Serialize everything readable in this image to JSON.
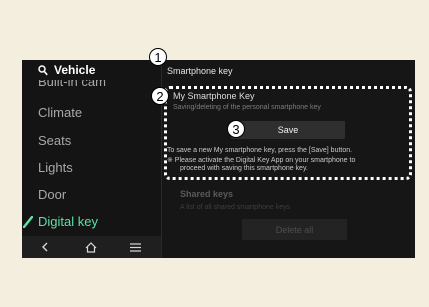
{
  "sidebar": {
    "title": "Vehicle",
    "items": [
      {
        "label": "Built-in cam"
      },
      {
        "label": "Climate"
      },
      {
        "label": "Seats"
      },
      {
        "label": "Lights"
      },
      {
        "label": "Door"
      },
      {
        "label": "Digital key"
      }
    ]
  },
  "content": {
    "title": "Smartphone key",
    "my_key": {
      "title": "My Smartphone Key",
      "subtitle": "Saving/deleting of the personal smartphone key",
      "save_label": "Save",
      "note_line1": "To save a new My smartphone key, press the [Save] button.",
      "note_line2": "※ Please activate the Digital Key App on your smartphone to",
      "note_line3": "proceed with saving this smartphone key."
    },
    "shared": {
      "title": "Shared keys",
      "subtitle": "A list of all shared smartphone keys",
      "delete_label": "Delete all"
    }
  },
  "callouts": [
    "1",
    "2",
    "3"
  ],
  "colors": {
    "accent": "#5fe0a6",
    "background": "#f3eede",
    "screen": "#161616"
  },
  "icons": [
    "search-icon",
    "leaf-icon",
    "back-icon",
    "home-icon",
    "menu-icon"
  ]
}
